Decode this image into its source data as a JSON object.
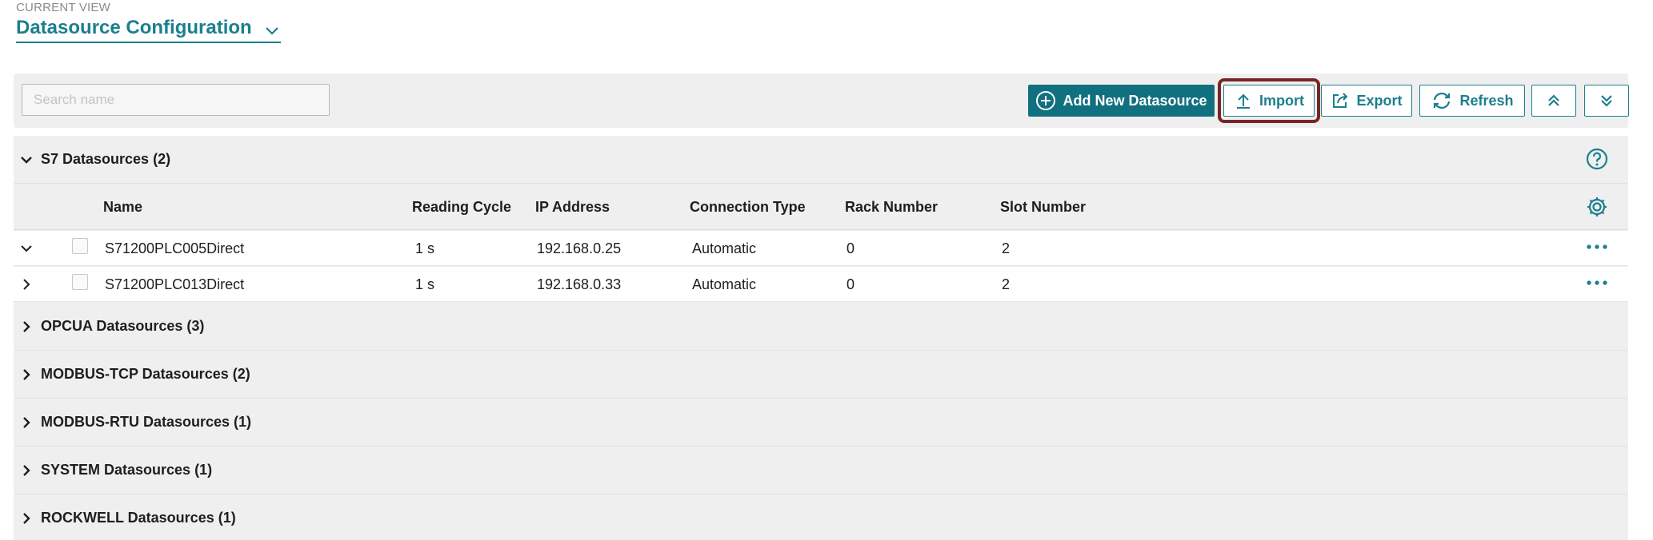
{
  "view": {
    "kicker": "CURRENT VIEW",
    "title": "Datasource Configuration"
  },
  "toolbar": {
    "search_placeholder": "Search name",
    "search_value": "",
    "add_label": "Add New Datasource",
    "import_label": "Import",
    "export_label": "Export",
    "refresh_label": "Refresh"
  },
  "groups": [
    {
      "label": "S7 Datasources (2)",
      "expanded": true
    },
    {
      "label": "OPCUA Datasources (3)",
      "expanded": false
    },
    {
      "label": "MODBUS-TCP Datasources (2)",
      "expanded": false
    },
    {
      "label": "MODBUS-RTU Datasources (1)",
      "expanded": false
    },
    {
      "label": "SYSTEM Datasources (1)",
      "expanded": false
    },
    {
      "label": "ROCKWELL Datasources (1)",
      "expanded": false
    }
  ],
  "table": {
    "columns": {
      "name": "Name",
      "reading_cycle": "Reading Cycle",
      "ip": "IP Address",
      "connection": "Connection Type",
      "rack": "Rack Number",
      "slot": "Slot Number"
    },
    "rows": [
      {
        "name": "S71200PLC005Direct",
        "reading_cycle": "1 s",
        "ip": "192.168.0.25",
        "connection": "Automatic",
        "rack": "0",
        "slot": "2",
        "expanded": true
      },
      {
        "name": "S71200PLC013Direct",
        "reading_cycle": "1 s",
        "ip": "192.168.0.33",
        "connection": "Automatic",
        "rack": "0",
        "slot": "2",
        "expanded": false
      }
    ]
  },
  "icons": {
    "view_dropdown": "chevron-down-icon",
    "add": "plus-circle-icon",
    "import": "upload-icon",
    "export": "export-icon",
    "refresh": "refresh-icon",
    "collapse_all": "double-chevron-up-icon",
    "expand_all": "double-chevron-down-icon",
    "help": "help-icon",
    "settings": "gear-icon",
    "row_menu": "more-horizontal-icon"
  },
  "colors": {
    "accent": "#1b7f8e",
    "primary_button": "#11707f",
    "focus_ring": "#7a2424",
    "panel_bg": "#efefef"
  }
}
